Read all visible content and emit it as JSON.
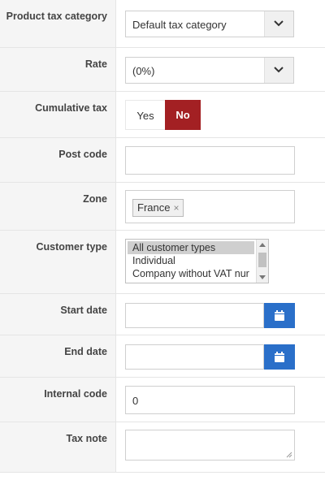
{
  "fields": {
    "product_tax_category": {
      "label": "Product tax category",
      "value": "Default tax category"
    },
    "rate": {
      "label": "Rate",
      "value": "(0%)"
    },
    "cumulative_tax": {
      "label": "Cumulative tax",
      "yes": "Yes",
      "no": "No",
      "selected": "No"
    },
    "post_code": {
      "label": "Post code",
      "value": ""
    },
    "zone": {
      "label": "Zone",
      "tags": [
        "France"
      ],
      "remove_glyph": "×"
    },
    "customer_type": {
      "label": "Customer type",
      "options": [
        "All customer types",
        "Individual",
        "Company without VAT nur"
      ],
      "selected": "All customer types"
    },
    "start_date": {
      "label": "Start date",
      "value": ""
    },
    "end_date": {
      "label": "End date",
      "value": ""
    },
    "internal_code": {
      "label": "Internal code",
      "value": "0"
    },
    "tax_note": {
      "label": "Tax note",
      "value": ""
    }
  },
  "icons": {
    "select_arrow": "chevron-down-icon",
    "date_button": "calendar-icon"
  },
  "colors": {
    "no_active": "#a32023",
    "date_button": "#2a6fc9",
    "label_bg": "#f5f5f5"
  }
}
